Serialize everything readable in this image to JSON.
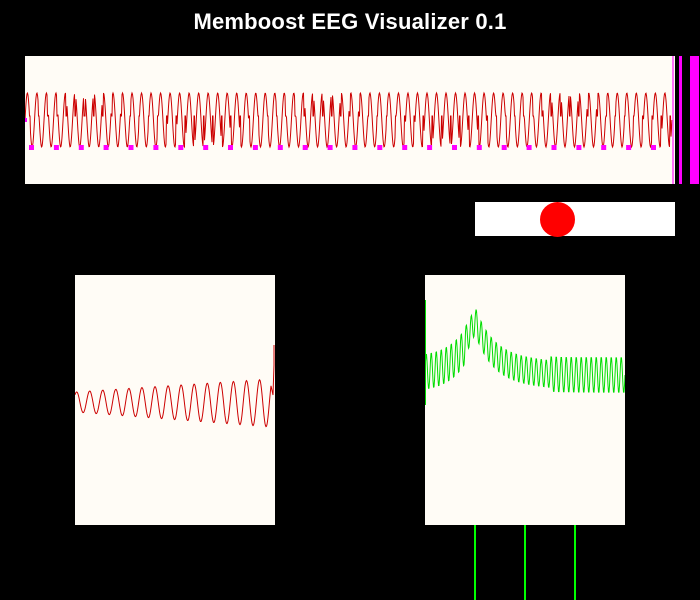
{
  "app": {
    "title": "Memboost EEG Visualizer 0.1"
  },
  "colors": {
    "background": "#000000",
    "panel": "#fffcf6",
    "raw_trace": "#cc0000",
    "filtered_trace": "#cc0000",
    "spectrum_trace": "#00dd00",
    "markers": "#ff00ff",
    "slider_track": "#ffffff",
    "slider_knob": "#ff0000",
    "band_lines": "#00ff00"
  },
  "raw_signal": {
    "cycles": 68,
    "marker_count": 26
  },
  "filtered_signal": {
    "cycles": 15
  },
  "spectrum": {
    "peak_count": 40
  },
  "slider": {
    "value": 0.33
  }
}
